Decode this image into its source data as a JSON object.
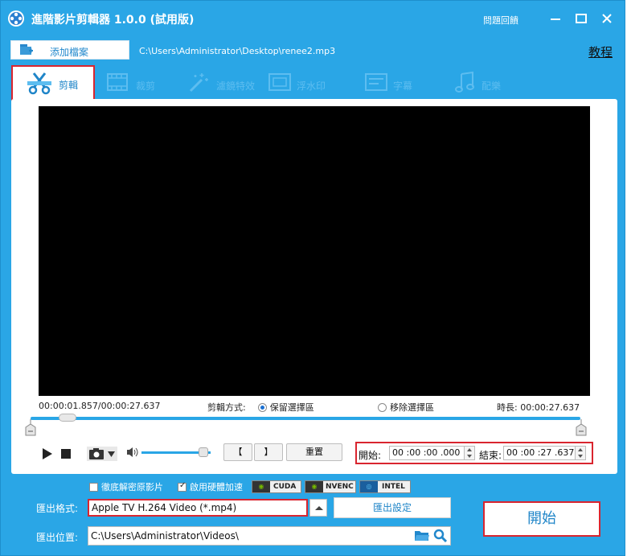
{
  "window": {
    "title": "進階影片剪輯器 1.0.0 (試用版)",
    "feedback": "問題回饋",
    "minimize": "—",
    "maximize": "☐",
    "close": "✕"
  },
  "toolbar": {
    "add_file": "添加檔案",
    "file_path": "C:\\Users\\Administrator\\Desktop\\renee2.mp3",
    "tutorial": "教程"
  },
  "tabs": [
    {
      "label": "剪輯",
      "icon": "scissors-film-icon",
      "active": true
    },
    {
      "label": "裁剪",
      "icon": "crop-film-icon",
      "active": false
    },
    {
      "label": "濾鏡特效",
      "icon": "magic-wand-icon",
      "active": false
    },
    {
      "label": "浮水印",
      "icon": "watermark-icon",
      "active": false
    },
    {
      "label": "字幕",
      "icon": "subtitle-icon",
      "active": false
    },
    {
      "label": "配樂",
      "icon": "music-note-icon",
      "active": false
    }
  ],
  "player": {
    "current_time": "00:00:01.857",
    "separator": "/",
    "total_time": "00:00:27.637",
    "cut_mode_label": "剪輯方式:",
    "keep_label": "保留選擇區",
    "remove_label": "移除選擇區",
    "duration_label": "時長:",
    "duration": "00:00:27.637",
    "keep_selected": true,
    "position_fraction": 0.067
  },
  "controls": {
    "bracket_open": "【",
    "bracket_close": "】",
    "reset": "重置",
    "start_label": "開始:",
    "start_value": "00 :00 :00 .000",
    "end_label": "結束:",
    "end_value": "00 :00 :27 .637",
    "volume_fraction": 0.9
  },
  "output": {
    "disable_decode": "徹底解密原影片",
    "disable_decode_checked": false,
    "hw_accel": "啟用硬體加速",
    "hw_accel_checked": true,
    "badges": [
      "CUDA",
      "NVENC",
      "INTEL"
    ],
    "format_label": "匯出格式:",
    "format_value": "Apple TV H.264 Video (*.mp4)",
    "settings_button": "匯出設定",
    "location_label": "匯出位置:",
    "location_value": "C:\\Users\\Administrator\\Videos\\",
    "start_button": "開始"
  },
  "colors": {
    "accent": "#2aa6e6",
    "highlight_border": "#d9252f",
    "tab_text": "#5dbdf0"
  }
}
